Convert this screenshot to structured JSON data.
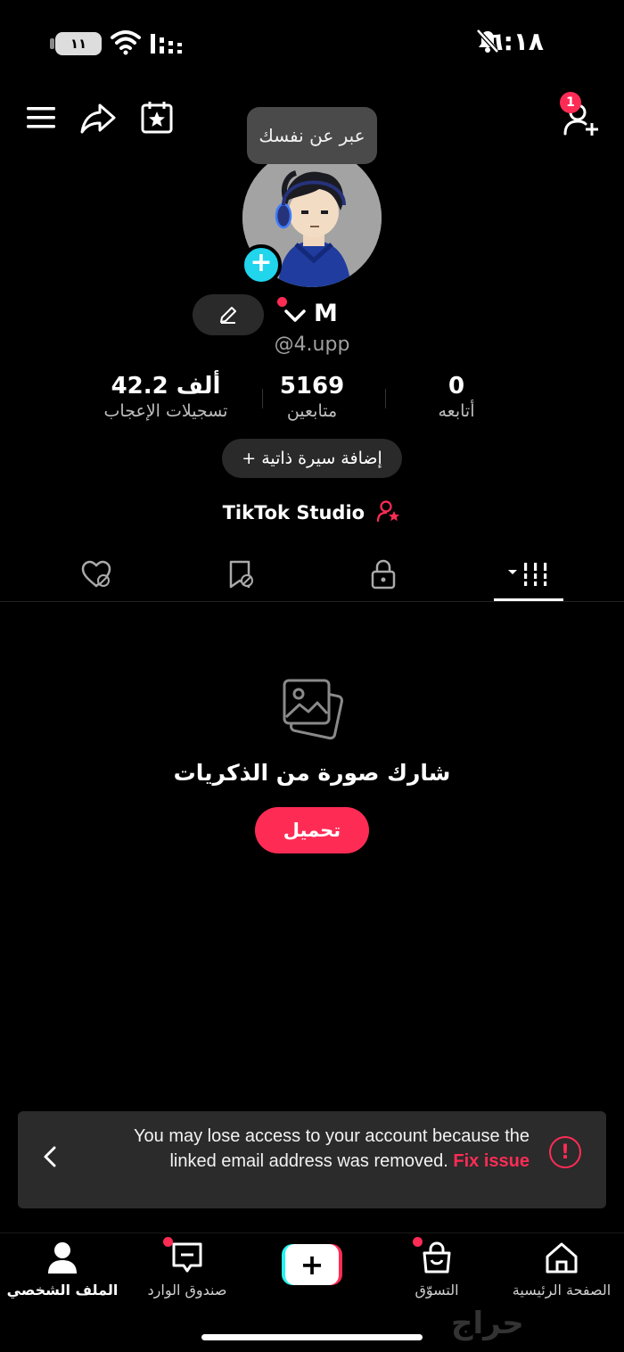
{
  "status_bar": {
    "time": "٦:١٨",
    "battery": "١١",
    "icons": [
      "mute-bell-icon",
      "wifi-icon",
      "signal-icon",
      "battery-icon"
    ]
  },
  "top_bar": {
    "menu_icon": "hamburger-menu-icon",
    "share_icon": "share-icon",
    "calendar_icon": "calendar-star-icon",
    "add_friend_icon": "add-friend-icon",
    "add_friend_badge": "1"
  },
  "profile": {
    "tooltip": "عبر عن نفسك",
    "name": "M",
    "username": "@4.upp",
    "stats": [
      {
        "value": "0",
        "label": "أتابعه"
      },
      {
        "value": "5169",
        "label": "متابعين"
      },
      {
        "value": "42.2 ألف",
        "label": "تسجيلات الإعجاب"
      }
    ],
    "add_bio": "+ إضافة سيرة ذاتية",
    "studio_link": "TikTok Studio"
  },
  "tabs": [
    "videos-grid-icon",
    "lock-icon",
    "bookmark-icon",
    "liked-icon"
  ],
  "empty_state": {
    "title": "شارك صورة من الذكريات",
    "button": "تحميل"
  },
  "banner": {
    "message": "You may lose access to your account because the linked email address was removed.",
    "action": "Fix issue"
  },
  "bottom_nav": [
    {
      "label": "الصفحة الرئيسية",
      "icon": "home-icon"
    },
    {
      "label": "التسوّق",
      "icon": "shop-bag-icon"
    },
    {
      "label": "",
      "icon": "create-plus-icon"
    },
    {
      "label": "صندوق الوارد",
      "icon": "inbox-icon"
    },
    {
      "label": "الملف الشخصي",
      "icon": "profile-icon"
    }
  ],
  "watermark": "حراج",
  "colors": {
    "accent": "#fe2c55",
    "cyan": "#25f4ee",
    "background": "#000000"
  }
}
